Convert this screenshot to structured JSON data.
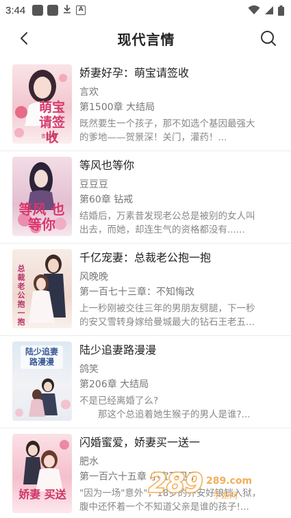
{
  "status_bar": {
    "time": "3:44"
  },
  "header": {
    "title": "现代言情"
  },
  "books": [
    {
      "title": "娇妻好孕：萌宝请签收",
      "author": "言欢",
      "chapter": "第1500章 大结局",
      "desc_line1": "既然要生一个孩子，那不如选个基因最强大",
      "desc_line2": "的爹地——贺景深！关门，灌药！...",
      "cover_text": "萌宝 请签收",
      "cover_author": "言欢 著",
      "cover_color": "#f6d7dc"
    },
    {
      "title": "等风也等你",
      "author": "豆豆豆",
      "chapter": "第60章 钻戒",
      "desc_line1": "结婚后，万素昔发现老公总是被别的女人叫",
      "desc_line2": "出去，而她，却连生气的资格都没有......",
      "cover_text": "等风 也等你",
      "cover_color": "#e9c9d6"
    },
    {
      "title": "千亿宠妻：总裁老公抱一抱",
      "author": "风晚晚",
      "chapter": "第一百七十三章：不知悔改",
      "desc_line1": "上一秒刚被交往三年的男朋友劈腿，下一秒",
      "desc_line2": "的安又雪转身嫁给曼城最大的钻石王老五...",
      "cover_text": "总裁老公抱一抱",
      "cover_color": "#f3e3dc"
    },
    {
      "title": "陆少追妻路漫漫",
      "author": "鸽笑",
      "chapter": "第206章 大结局",
      "desc_line1": "不是已经离婚了么?",
      "desc_line2": "　　那这个总追着她生猴子的男人是谁?...",
      "cover_text": "陆少追妻 路漫漫",
      "cover_color": "#dfe8f3"
    },
    {
      "title": "闪婚蜜爱，娇妻买一送一",
      "author": "肥水",
      "chapter": "第一百六十五章  小宝不见了",
      "desc_line1": "\"因为一场\"意外\"，18岁的乔安好锒铛入狱，",
      "desc_line2": "腹中还怀着一个不知道父亲是谁的孩子!...",
      "cover_text": "娇妻 买送",
      "cover_color": "#f7d2dc"
    }
  ],
  "watermark": {
    "text": "289.com",
    "subtext": "手游网"
  }
}
